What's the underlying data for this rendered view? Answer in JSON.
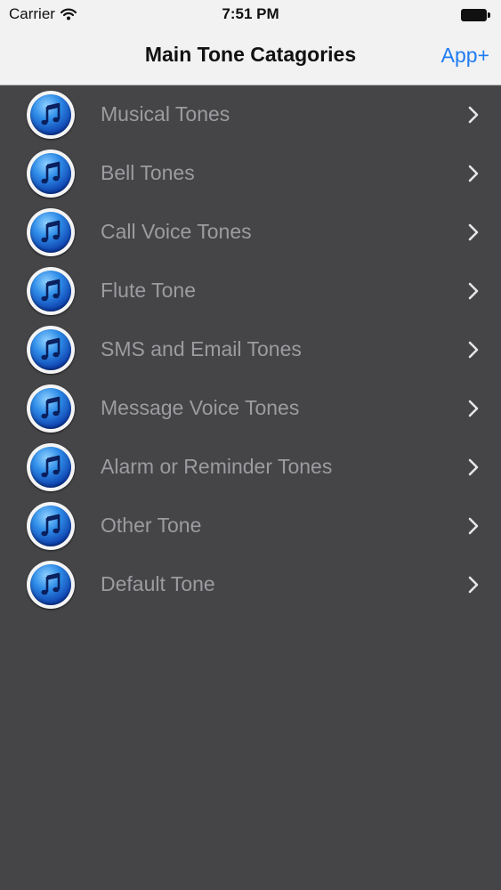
{
  "status_bar": {
    "carrier": "Carrier",
    "time": "7:51 PM",
    "icons": [
      "wifi-icon",
      "battery-icon"
    ]
  },
  "nav_bar": {
    "title": "Main Tone Catagories",
    "action_label": "App+"
  },
  "colors": {
    "background": "#454547",
    "nav_background": "#f2f2f3",
    "accent": "#1f7cf2",
    "row_text": "#9c9ca0"
  },
  "categories": [
    {
      "label": "Musical Tones",
      "icon": "music-note-icon"
    },
    {
      "label": "Bell Tones",
      "icon": "music-note-icon"
    },
    {
      "label": "Call Voice Tones",
      "icon": "music-note-icon"
    },
    {
      "label": "Flute Tone",
      "icon": "music-note-icon"
    },
    {
      "label": "SMS and Email Tones",
      "icon": "music-note-icon"
    },
    {
      "label": "Message Voice Tones",
      "icon": "music-note-icon"
    },
    {
      "label": "Alarm or Reminder Tones",
      "icon": "music-note-icon"
    },
    {
      "label": "Other Tone",
      "icon": "music-note-icon"
    },
    {
      "label": "Default Tone",
      "icon": "music-note-icon"
    }
  ]
}
